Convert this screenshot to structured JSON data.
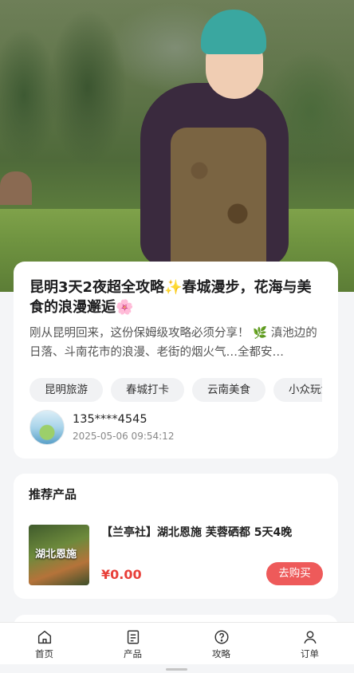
{
  "article": {
    "title_text": "昆明3天2夜超全攻略",
    "title_sparkle_icon": "sparkles-emoji",
    "title_text_2": "春城漫步，花海与美食的浪漫邂逅",
    "title_flower_icon": "cherry-blossom-emoji",
    "excerpt_line1": "刚从昆明回来，这份保姆级攻略必须分享！",
    "excerpt_herb_icon": "herb-emoji",
    "excerpt_line2": "滇池边的日落、斗南花市的浪漫、老街的烟火气…全都安…",
    "tags": [
      "昆明旅游",
      "春城打卡",
      "云南美食",
      "小众玩法"
    ],
    "author_name": "135****4545",
    "publish_time": "2025-05-06 09:54:12"
  },
  "recommend": {
    "section_title": "推荐产品",
    "product_name": "【兰亭社】湖北恩施 芙蓉硒都 5天4晚",
    "thumb_text": "湖北恩施",
    "price": "¥0.00",
    "buy_label": "去购买"
  },
  "tabbar": {
    "items": [
      {
        "label": "首页",
        "icon": "home-icon"
      },
      {
        "label": "产品",
        "icon": "document-icon"
      },
      {
        "label": "攻略",
        "icon": "help-circle-icon"
      },
      {
        "label": "订单",
        "icon": "user-icon"
      }
    ]
  },
  "colors": {
    "price": "#e8403a",
    "buy_button": "#ee5a5a",
    "tag_bg": "#f1f2f4"
  }
}
